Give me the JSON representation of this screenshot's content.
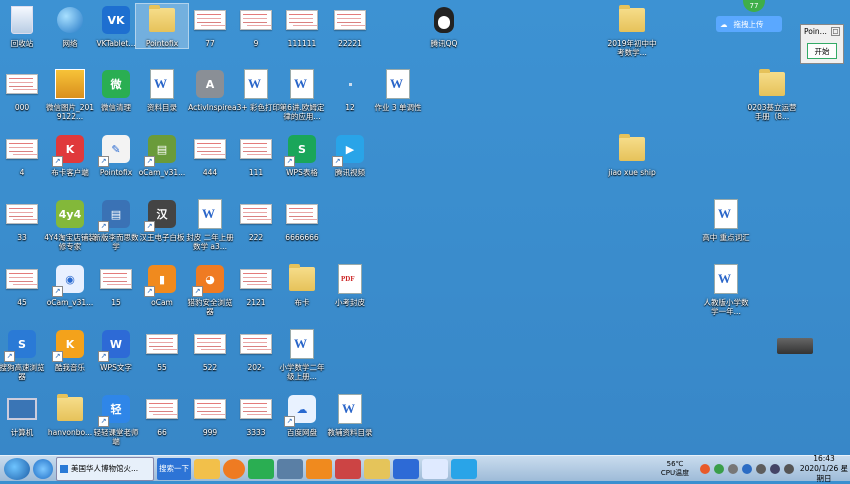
{
  "desktop": {
    "icons": [
      {
        "label": "回收站",
        "kind": "recycle"
      },
      {
        "label": "网络",
        "kind": "network"
      },
      {
        "label": "VKTablet...",
        "kind": "app",
        "color": "#1e6fd0",
        "glyph": "VK"
      },
      {
        "label": "Pointofix",
        "kind": "folder"
      },
      {
        "label": "77",
        "kind": "thumb"
      },
      {
        "label": "9",
        "kind": "thumb"
      },
      {
        "label": "111111",
        "kind": "thumb"
      },
      {
        "label": "22221",
        "kind": "thumb"
      },
      {
        "label": "腾讯QQ",
        "kind": "qq"
      },
      {
        "label": "2019年初中中考数学...",
        "kind": "folder"
      },
      {
        "label": "000",
        "kind": "thumb"
      },
      {
        "label": "微信图片_2019122...",
        "kind": "photo"
      },
      {
        "label": "微信清理",
        "kind": "app",
        "color": "#2aae52",
        "glyph": "微"
      },
      {
        "label": "资料目录",
        "kind": "doc"
      },
      {
        "label": "ActivInspire",
        "kind": "app",
        "color": "#8a8f96",
        "glyph": "A"
      },
      {
        "label": "a3+ 彩色打印",
        "kind": "doc"
      },
      {
        "label": "第6讲.欧姆定律的应用...",
        "kind": "doc"
      },
      {
        "label": "12",
        "kind": "blank"
      },
      {
        "label": "作业 3 单调性",
        "kind": "doc"
      },
      {
        "label": "0203基立运营手册（8...",
        "kind": "folder"
      },
      {
        "label": "4",
        "kind": "thumb"
      },
      {
        "label": "布卡客户端",
        "kind": "app",
        "color": "#e0393b",
        "glyph": "K"
      },
      {
        "label": "Pointofix",
        "kind": "app",
        "color": "#f3f3f3",
        "glyph": "✎"
      },
      {
        "label": "oCam_v31...",
        "kind": "app",
        "color": "#6a9b3a",
        "glyph": "▤"
      },
      {
        "label": "444",
        "kind": "thumb"
      },
      {
        "label": "111",
        "kind": "thumb"
      },
      {
        "label": "WPS表格",
        "kind": "app",
        "color": "#1aa65a",
        "glyph": "S"
      },
      {
        "label": "腾讯视频",
        "kind": "app",
        "color": "#29a4e8",
        "glyph": "▶"
      },
      {
        "label": "jiao xue ship",
        "kind": "folder"
      },
      {
        "label": "33",
        "kind": "thumb"
      },
      {
        "label": "4Y4淘宝店铺装修专家",
        "kind": "app",
        "color": "#83b83a",
        "glyph": "4y4"
      },
      {
        "label": "新版李而思数学",
        "kind": "app",
        "color": "#3a72b5",
        "glyph": "▤"
      },
      {
        "label": "汉王电子白板",
        "kind": "app",
        "color": "#444",
        "glyph": "汉"
      },
      {
        "label": "封皮 二年上册 数学 a3...",
        "kind": "doc"
      },
      {
        "label": "222",
        "kind": "thumb"
      },
      {
        "label": "6666666",
        "kind": "thumb"
      },
      {
        "label": "高中 重点词汇",
        "kind": "doc"
      },
      {
        "label": "45",
        "kind": "thumb"
      },
      {
        "label": "oCam_v31...",
        "kind": "app",
        "color": "#e8f0ff",
        "glyph": "◉"
      },
      {
        "label": "15",
        "kind": "thumb"
      },
      {
        "label": "oCam",
        "kind": "app",
        "color": "#f08a1e",
        "glyph": "▮"
      },
      {
        "label": "猎豹安全浏览器",
        "kind": "app",
        "color": "#ef7b22",
        "glyph": "◕"
      },
      {
        "label": "2121",
        "kind": "thumb"
      },
      {
        "label": "布卡",
        "kind": "folder"
      },
      {
        "label": "小考封皮",
        "kind": "pdf"
      },
      {
        "label": "人教版小学数学一年...",
        "kind": "doc"
      },
      {
        "label": "搜狗高速浏览器",
        "kind": "app",
        "color": "#2a7ad6",
        "glyph": "S"
      },
      {
        "label": "酷我音乐",
        "kind": "app",
        "color": "#f4a21b",
        "glyph": "K"
      },
      {
        "label": "WPS文字",
        "kind": "app",
        "color": "#2d6ad6",
        "glyph": "W"
      },
      {
        "label": "55",
        "kind": "thumb"
      },
      {
        "label": "522",
        "kind": "thumb"
      },
      {
        "label": "202-",
        "kind": "thumb"
      },
      {
        "label": "小学数学二年级上册...",
        "kind": "doc"
      },
      {
        "label": "计算机",
        "kind": "computer"
      },
      {
        "label": "hanvonbo...",
        "kind": "folder"
      },
      {
        "label": "轻轻课堂老师端",
        "kind": "app",
        "color": "#2f86e8",
        "glyph": "轻"
      },
      {
        "label": "66",
        "kind": "thumb"
      },
      {
        "label": "999",
        "kind": "thumb"
      },
      {
        "label": "3333",
        "kind": "thumb"
      },
      {
        "label": "百度网盘",
        "kind": "app",
        "color": "#e9f2ff",
        "glyph": "☁"
      },
      {
        "label": "教辅资料目录",
        "kind": "doc"
      }
    ]
  },
  "widgets": {
    "pointofix_title": "Poin...",
    "pointofix_start": "开始",
    "baidu_float": "拖拽上传",
    "green_badge": "77"
  },
  "taskbar": {
    "ie_tab": "美国华人博物馆火...",
    "search_tab": "搜索一下",
    "cpu_temp": "56℃",
    "cpu_label": "CPU温度",
    "time": "16:43",
    "date": "2020/1/26 星期日"
  }
}
